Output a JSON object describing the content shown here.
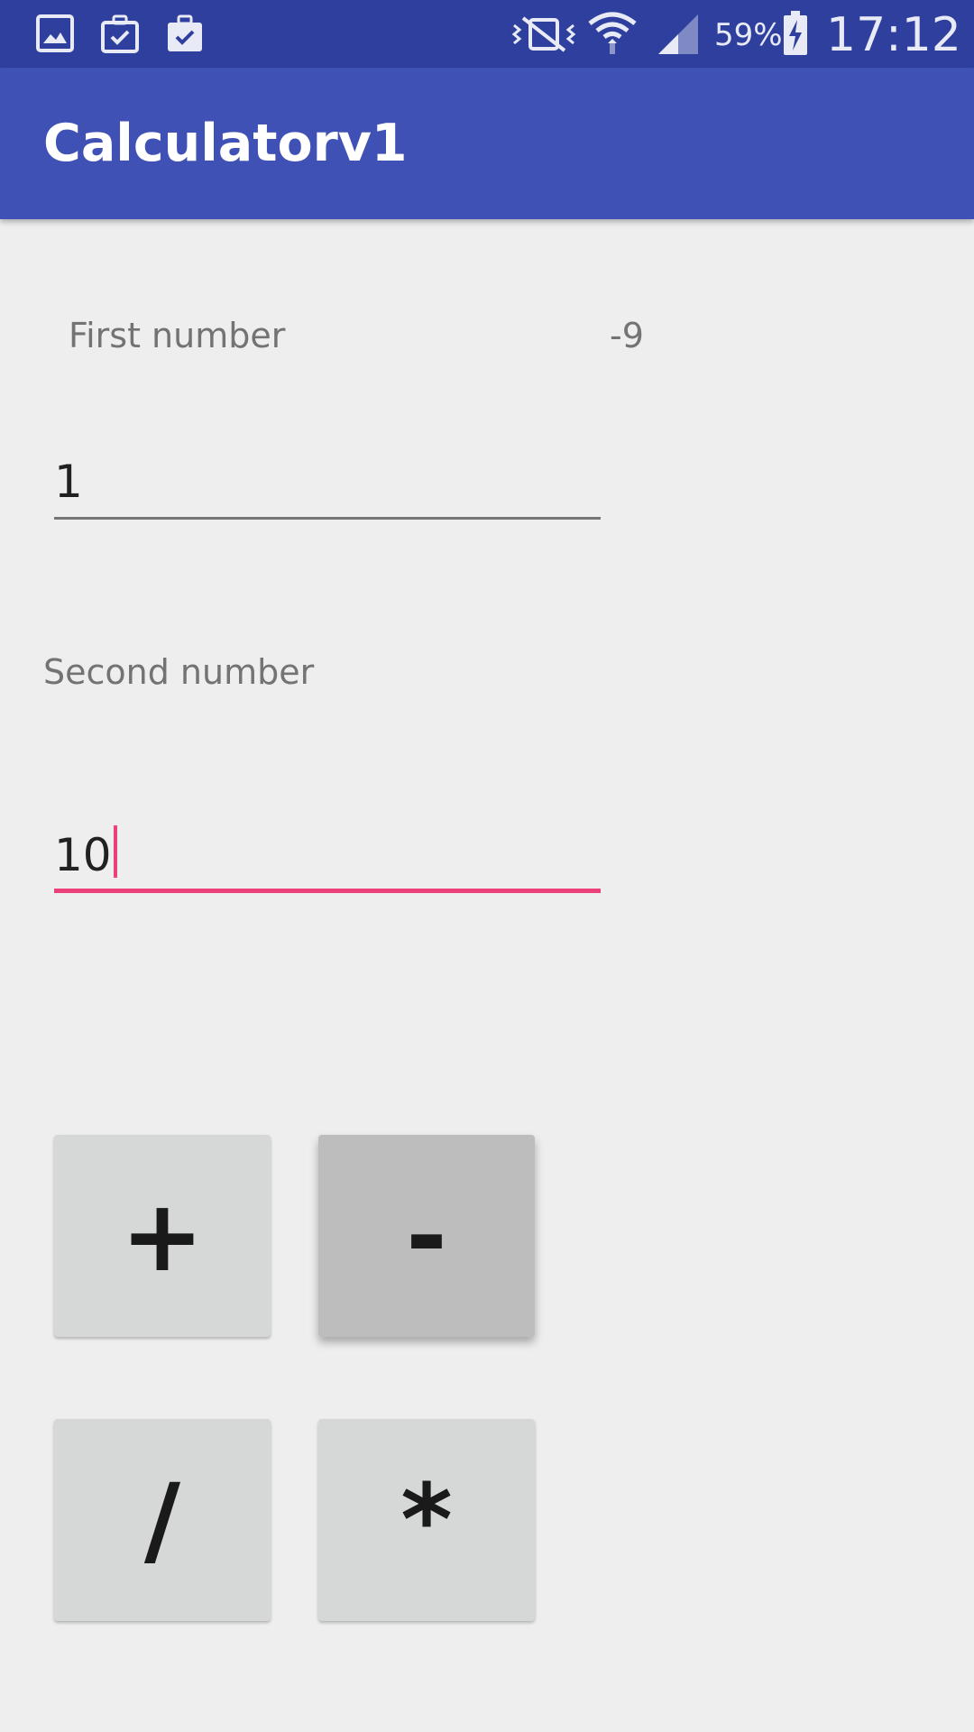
{
  "status_bar": {
    "battery": "59%",
    "time": "17:12",
    "icons": [
      "gallery-icon",
      "briefcase-check-icon",
      "briefcase-check-icon",
      "vibrate-mute-icon",
      "wifi-icon",
      "signal-icon",
      "battery-charging-icon"
    ]
  },
  "app_bar": {
    "title": "Calculatorv1"
  },
  "form": {
    "first_label": "First number",
    "result": "-9",
    "first_value": "1",
    "second_label": "Second number",
    "second_value": "10"
  },
  "buttons": {
    "add": "+",
    "subtract": "-",
    "divide": "/",
    "multiply": "*"
  },
  "colors": {
    "primary": "#3f51b5",
    "primary_dark": "#2f3f9e",
    "accent": "#ec407a",
    "background": "#eeeeee",
    "button": "#d6d7d7",
    "button_pressed": "#bcbdbc"
  }
}
